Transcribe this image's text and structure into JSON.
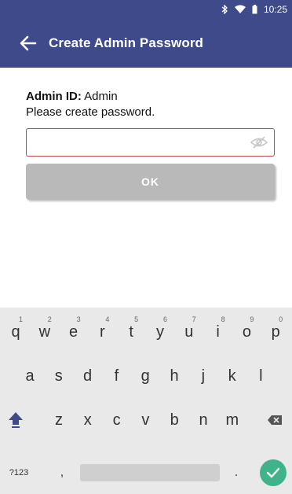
{
  "status_bar": {
    "time": "10:25",
    "bluetooth_icon": "bluetooth-icon",
    "wifi_icon": "wifi-icon",
    "battery_icon": "battery-icon"
  },
  "app_bar": {
    "title": "Create Admin Password",
    "back_icon": "arrow-left-icon"
  },
  "form": {
    "admin_id_label": "Admin ID:",
    "admin_id_value": "Admin",
    "instruction": "Please create password.",
    "password_value": "",
    "eye_icon": "eye-off-icon",
    "ok_label": "OK"
  },
  "keyboard": {
    "row1": [
      {
        "k": "q",
        "n": "1"
      },
      {
        "k": "w",
        "n": "2"
      },
      {
        "k": "e",
        "n": "3"
      },
      {
        "k": "r",
        "n": "4"
      },
      {
        "k": "t",
        "n": "5"
      },
      {
        "k": "y",
        "n": "6"
      },
      {
        "k": "u",
        "n": "7"
      },
      {
        "k": "i",
        "n": "8"
      },
      {
        "k": "o",
        "n": "9"
      },
      {
        "k": "p",
        "n": "0"
      }
    ],
    "row2": [
      "a",
      "s",
      "d",
      "f",
      "g",
      "h",
      "j",
      "k",
      "l"
    ],
    "row3": [
      "z",
      "x",
      "c",
      "v",
      "b",
      "n",
      "m"
    ],
    "shift_icon": "shift-icon",
    "backspace_icon": "backspace-icon",
    "symbols_label": "?123",
    "comma_label": ",",
    "period_label": ".",
    "enter_icon": "check-icon",
    "colors": {
      "enter_bg": "#41b38a"
    }
  },
  "colors": {
    "app_bar_bg": "#3f4a8a",
    "field_border": "#c0484a",
    "ok_bg": "#b9b9b9"
  }
}
